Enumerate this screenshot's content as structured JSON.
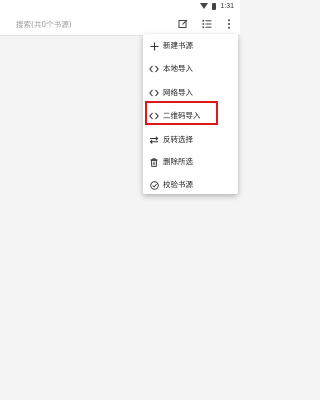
{
  "status_bar": {
    "time": "1:31",
    "icons": [
      "wifi-icon",
      "battery-icon"
    ]
  },
  "search": {
    "placeholder": "搜索(共0个书源)",
    "value": ""
  },
  "toolbar": {
    "buttons": [
      {
        "name": "edit-icon",
        "interactable": true
      },
      {
        "name": "sort-icon",
        "interactable": true
      },
      {
        "name": "more-vert-icon",
        "interactable": true
      }
    ]
  },
  "menu": {
    "items": [
      {
        "label": "新建书源",
        "icon": "plus-icon"
      },
      {
        "label": "本地导入",
        "icon": "code-icon"
      },
      {
        "label": "网络导入",
        "icon": "code-icon"
      },
      {
        "label": "二维码导入",
        "icon": "code-icon",
        "highlighted": true
      },
      {
        "label": "反转选择",
        "icon": "swap-icon"
      },
      {
        "label": "删除所选",
        "icon": "trash-icon"
      },
      {
        "label": "校验书源",
        "icon": "check-badge-icon"
      }
    ],
    "highlight_color": "#e01818"
  }
}
